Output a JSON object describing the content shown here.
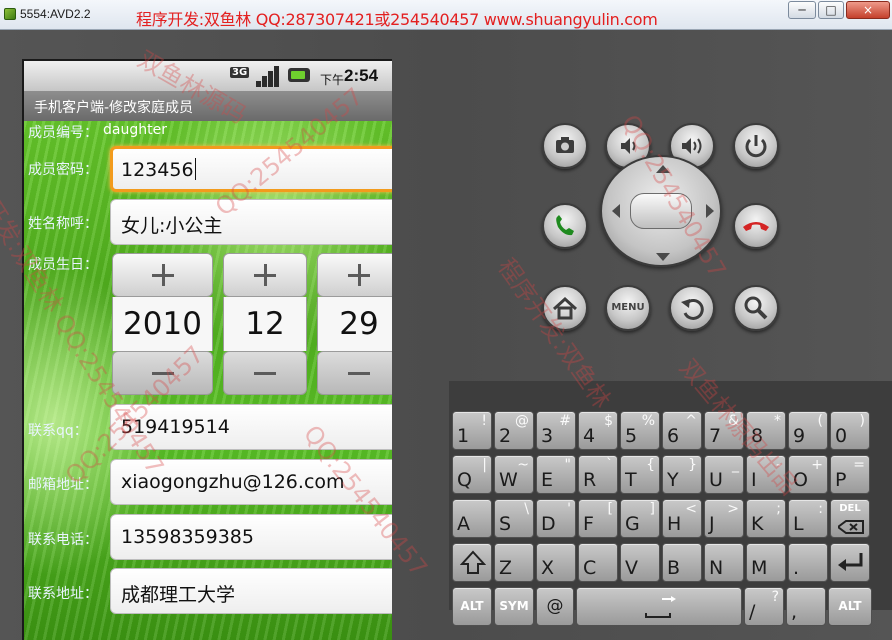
{
  "window": {
    "title": "5554:AVD2.2",
    "banner": "程序开发:双鱼林 QQ:287307421或254540457 www.shuangyulin.com",
    "minimize": "─",
    "maximize": "□",
    "close": "×"
  },
  "statusbar": {
    "network": "3G",
    "ampm": "下午",
    "time": "2:54"
  },
  "app": {
    "title": "手机客户端-修改家庭成员"
  },
  "form": {
    "member_id_label": "成员编号：",
    "member_id_value": "daughter",
    "password_label": "成员密码：",
    "password_value": "123456",
    "name_label": "姓名称呼：",
    "name_value": "女儿:小公主",
    "birthday_label": "成员生日：",
    "birthday": {
      "year": "2010",
      "month": "12",
      "day": "29"
    },
    "qq_label": "联系qq：",
    "qq_value": "519419514",
    "email_label": "邮箱地址：",
    "email_value": "xiaogongzhu@126.com",
    "phone_label": "联系电话：",
    "phone_value": "13598359385",
    "address_label": "联系地址：",
    "address_value": "成都理工大学"
  },
  "controls": {
    "menu_label": "MENU"
  },
  "keyboard": {
    "row1": [
      {
        "m": "1",
        "s": "!"
      },
      {
        "m": "2",
        "s": "@"
      },
      {
        "m": "3",
        "s": "#"
      },
      {
        "m": "4",
        "s": "$"
      },
      {
        "m": "5",
        "s": "%"
      },
      {
        "m": "6",
        "s": "^"
      },
      {
        "m": "7",
        "s": "&"
      },
      {
        "m": "8",
        "s": "*"
      },
      {
        "m": "9",
        "s": "("
      },
      {
        "m": "0",
        "s": ")"
      }
    ],
    "row2": [
      {
        "m": "Q",
        "s": "|"
      },
      {
        "m": "W",
        "s": "~"
      },
      {
        "m": "E",
        "s": "\""
      },
      {
        "m": "R",
        "s": "`"
      },
      {
        "m": "T",
        "s": "{"
      },
      {
        "m": "Y",
        "s": "}"
      },
      {
        "m": "U",
        "s": "_"
      },
      {
        "m": "I",
        "s": "-"
      },
      {
        "m": "O",
        "s": "+"
      },
      {
        "m": "P",
        "s": "="
      }
    ],
    "row3": [
      {
        "m": "A",
        "s": ""
      },
      {
        "m": "S",
        "s": "\\"
      },
      {
        "m": "D",
        "s": "'"
      },
      {
        "m": "F",
        "s": "["
      },
      {
        "m": "G",
        "s": "]"
      },
      {
        "m": "H",
        "s": "<"
      },
      {
        "m": "J",
        "s": ">"
      },
      {
        "m": "K",
        "s": ";"
      },
      {
        "m": "L",
        "s": ":"
      }
    ],
    "del_label": "DEL",
    "row4": [
      {
        "m": "Z",
        "s": ""
      },
      {
        "m": "X",
        "s": ""
      },
      {
        "m": "C",
        "s": ""
      },
      {
        "m": "V",
        "s": ""
      },
      {
        "m": "B",
        "s": ""
      },
      {
        "m": "N",
        "s": ""
      },
      {
        "m": "M",
        "s": ""
      },
      {
        "m": ".",
        "s": ""
      }
    ],
    "alt_label": "ALT",
    "sym_label": "SYM",
    "at_label": "@",
    "slash_key": {
      "m": "/",
      "s": "?"
    },
    "comma_key": {
      "m": ",",
      "s": ""
    }
  },
  "watermarks": [
    "程序开发:双鱼林 QQ:254540457",
    "双鱼林源码",
    "QQ:254540457",
    "QQ:254540457",
    "程序开发:双鱼林",
    "QQ:254540457",
    "双鱼林源码出品",
    "QQ:254540457"
  ]
}
